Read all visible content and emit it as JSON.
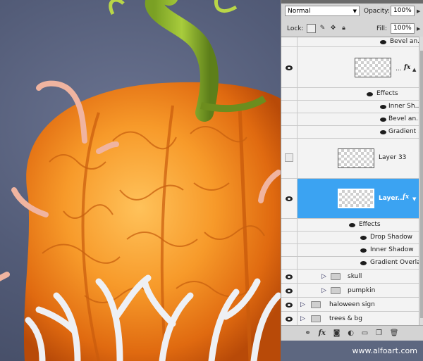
{
  "panel": {
    "blend_mode": "Normal",
    "opacity_label": "Opacity:",
    "opacity_value": "100%",
    "lock_label": "Lock:",
    "fill_label": "Fill:",
    "fill_value": "100%"
  },
  "layers": {
    "top_bevel": "Bevel an...",
    "layer_a_dots": "...",
    "fx_label": "fx",
    "effects_label": "Effects",
    "layer_a_effects": [
      "Inner Sh...",
      "Bevel an...",
      "Gradient ..."
    ],
    "layer33_name": "Layer 33",
    "selected_name": "Layer...",
    "selected_effects": [
      "Drop Shadow",
      "Inner Shadow",
      "Gradient Overlay"
    ],
    "groups": [
      "skull",
      "pumpkin",
      "haloween sign",
      "trees & bg"
    ]
  },
  "footer": {
    "credit": "www.alfoart.com"
  },
  "icons": [
    "eye-icon",
    "folder-icon",
    "chevron-right-icon",
    "link-icon",
    "fx-icon",
    "mask-icon",
    "adjustment-icon",
    "new-group-icon",
    "new-layer-icon",
    "trash-icon",
    "lock-icon",
    "brush-icon",
    "move-icon"
  ]
}
